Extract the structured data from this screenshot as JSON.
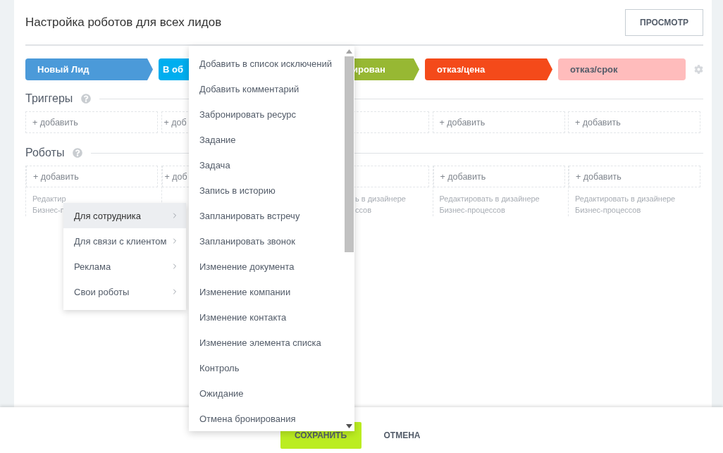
{
  "header": {
    "title": "Настройка роботов для всех лидов",
    "preview_button": "ПРОСМОТР"
  },
  "stages": [
    {
      "label": "Новый Лид",
      "color": "#4b9ad9"
    },
    {
      "label": "В об",
      "color": "#00aeef"
    },
    {
      "label": "ирован",
      "color": "#97b833"
    },
    {
      "label": "отказ/цена",
      "color": "#f44a1a"
    },
    {
      "label": "отказ/срок",
      "color": "#ffbcbc"
    }
  ],
  "triggers": {
    "title": "Триггеры",
    "cells": [
      {
        "add": "+ добавить"
      },
      {
        "add": "+ доб"
      },
      {},
      {
        "add": "+ добавить"
      },
      {
        "add": "+ добавить"
      }
    ]
  },
  "robots": {
    "title": "Роботы",
    "cells": [
      {
        "add": "+ добавить",
        "caption": [
          "Редактир",
          "Бизнес-п"
        ]
      },
      {
        "add": "+ доб"
      },
      {
        "caption": [
          "ь в дизайнере",
          "ссов"
        ]
      },
      {
        "add": "+ добавить",
        "caption": [
          "Редактировать в дизайнере",
          "Бизнес-процессов"
        ]
      },
      {
        "add": "+ добавить",
        "caption": [
          "Редактировать в дизайнере",
          "Бизнес-процессов"
        ]
      }
    ]
  },
  "category_menu": [
    {
      "label": "Для сотрудника",
      "selected": true
    },
    {
      "label": "Для связи с клиентом",
      "selected": false
    },
    {
      "label": "Реклама",
      "selected": false
    },
    {
      "label": "Свои роботы",
      "selected": false
    }
  ],
  "robot_list": [
    "Добавить в список исключений",
    "Добавить комментарий",
    "Забронировать ресурс",
    "Задание",
    "Задача",
    "Запись в историю",
    "Запланировать встречу",
    "Запланировать звонок",
    "Изменение документа",
    "Изменение компании",
    "Изменение контакта",
    "Изменение элемента списка",
    "Контроль",
    "Ожидание",
    "Отмена бронирования"
  ],
  "footer": {
    "save": "СОХРАНИТЬ",
    "cancel": "ОТМЕНА"
  }
}
